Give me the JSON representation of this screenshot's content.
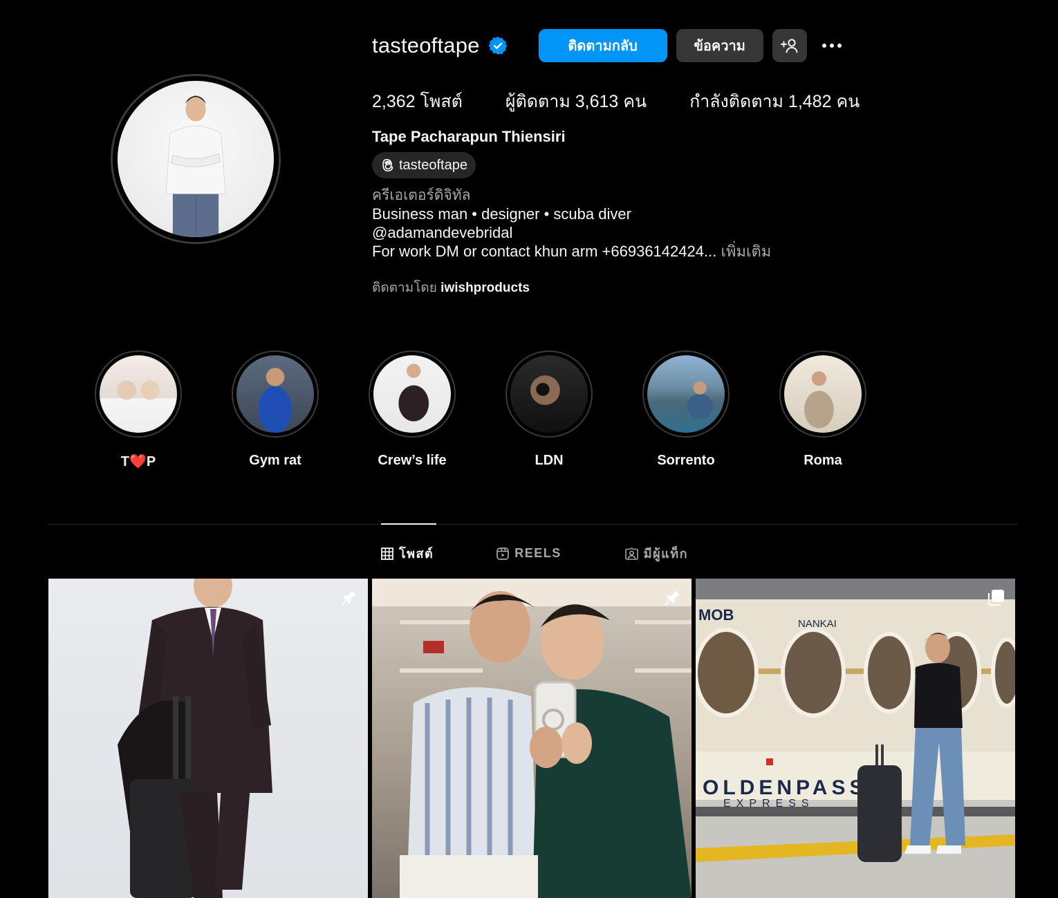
{
  "profile": {
    "username": "tasteoftape",
    "verified": true,
    "follow_back_label": "ติดตามกลับ",
    "message_label": "ข้อความ",
    "stats": {
      "posts": "2,362 โพสต์",
      "followers": "ผู้ติดตาม 3,613 คน",
      "following": "กำลังติดตาม 1,482 คน"
    },
    "full_name": "Tape Pacharapun Thiensiri",
    "threads_handle": "tasteoftape",
    "category": "ครีเอเตอร์ดิจิทัล",
    "bio": {
      "line1": "Business man • designer • scuba diver",
      "line2": "@adamandevebridal",
      "line3": "For work DM or contact khun arm +66936142424...",
      "more": "เพิ่มเติม"
    },
    "followed_by_prefix": "ติดตามโดย",
    "followed_by_user": "iwishproducts"
  },
  "highlights": [
    {
      "label_left": "T",
      "label_right": "P",
      "heart": "❤️"
    },
    {
      "label": "Gym rat"
    },
    {
      "label": "Crew’s life"
    },
    {
      "label": "LDN"
    },
    {
      "label": "Sorrento"
    },
    {
      "label": "Roma"
    }
  ],
  "tabs": {
    "posts": "โพสต์",
    "reels": "REELS",
    "tagged": "มีผู้แท็ก"
  },
  "posts_grid": {
    "train_sign_1": "MOB",
    "train_sign_2": "NANKAI",
    "train_sign_3": "OLDENPASS",
    "train_sign_4": "EXPRESS"
  },
  "colors": {
    "background": "#000000",
    "primary_button": "#0095f6",
    "secondary_button": "#363636",
    "muted_text": "#a8a8a8",
    "verified_badge": "#0095f6"
  },
  "icons": [
    "verified-badge-icon",
    "add-user-icon",
    "more-options-icon",
    "threads-icon",
    "grid-icon",
    "reels-icon",
    "tagged-icon",
    "pin-icon",
    "carousel-icon"
  ]
}
